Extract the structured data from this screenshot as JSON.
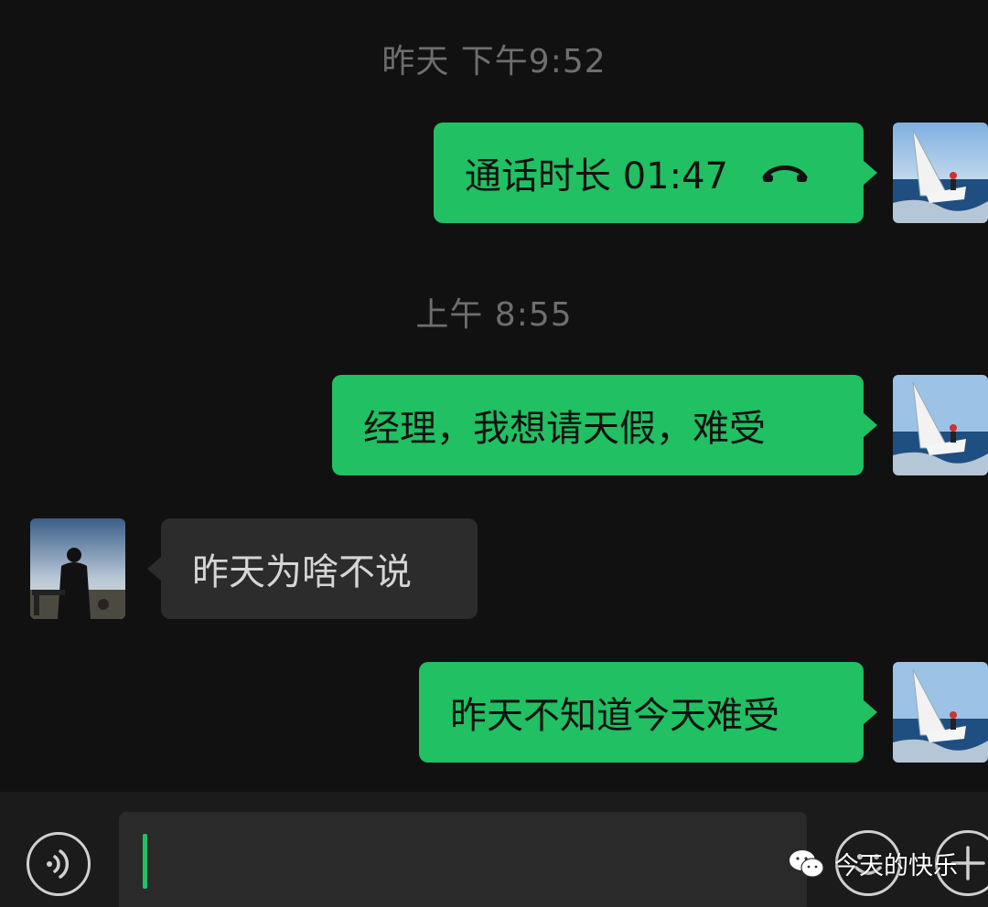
{
  "chat": {
    "timestamp_1": "昨天 下午9:52",
    "call_bubble": {
      "label": "通话时长 01:47",
      "icon": "phone-hangup-icon"
    },
    "timestamp_2": "上午 8:55",
    "msg_1": "经理，我想请天假，难受",
    "msg_2": "昨天为啥不说",
    "msg_3": "昨天不知道今天难受"
  },
  "input_bar": {
    "voice_icon": "voice-icon",
    "emoji_icon": "emoji-icon",
    "plus_icon": "plus-icon"
  },
  "watermark": {
    "text": "今天的快乐",
    "icon": "wechat-logo"
  },
  "colors": {
    "background": "#111111",
    "outgoing_bubble": "#21c062",
    "incoming_bubble": "#2c2c2c",
    "timestamp": "#6e6e6e"
  }
}
